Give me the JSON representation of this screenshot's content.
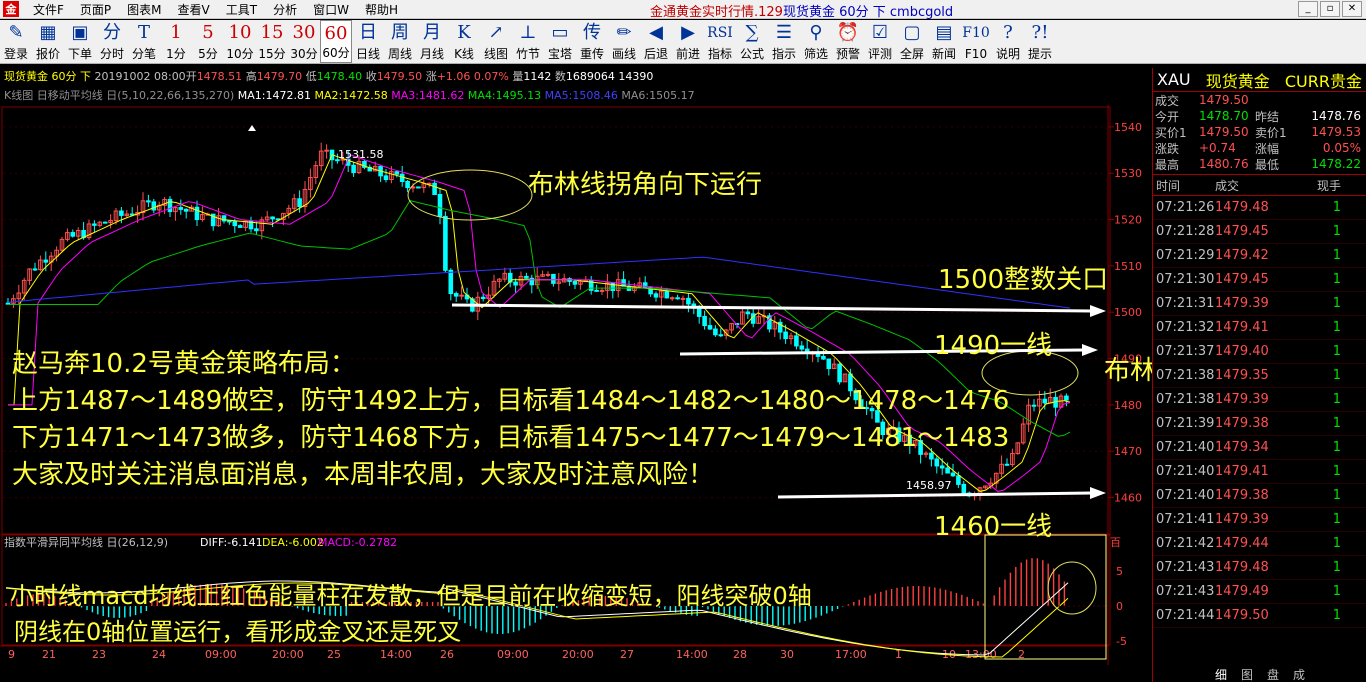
{
  "menubar": {
    "items": [
      "文件F",
      "页面P",
      "图表M",
      "查看V",
      "工具T",
      "分析",
      "窗口W",
      "帮助H"
    ],
    "title_prefix": "金通黄金实时行情.129",
    "title_main": "现货黄金 60分 下 cmbcgold"
  },
  "toolbar": [
    {
      "icon": "✎",
      "label": "登录"
    },
    {
      "icon": "▦",
      "label": "报价"
    },
    {
      "icon": "▣",
      "label": "下单"
    },
    {
      "icon": "分",
      "label": "分时"
    },
    {
      "icon": "T",
      "label": "分笔"
    },
    {
      "icon": "1",
      "label": "1分"
    },
    {
      "icon": "5",
      "label": "5分"
    },
    {
      "icon": "10",
      "label": "10分"
    },
    {
      "icon": "15",
      "label": "15分"
    },
    {
      "icon": "30",
      "label": "30分"
    },
    {
      "icon": "60",
      "label": "60分"
    },
    {
      "icon": "日",
      "label": "日线"
    },
    {
      "icon": "周",
      "label": "周线"
    },
    {
      "icon": "月",
      "label": "月线"
    },
    {
      "icon": "K",
      "label": "K线"
    },
    {
      "icon": "↗",
      "label": "线图"
    },
    {
      "icon": "⊥",
      "label": "竹节"
    },
    {
      "icon": "▭",
      "label": "宝塔"
    },
    {
      "icon": "传",
      "label": "重传"
    },
    {
      "icon": "✏",
      "label": "画线"
    },
    {
      "icon": "◀",
      "label": "后退"
    },
    {
      "icon": "▶",
      "label": "前进"
    },
    {
      "icon": "RSI",
      "label": "指标"
    },
    {
      "icon": "∑",
      "label": "公式"
    },
    {
      "icon": "☰",
      "label": "指示"
    },
    {
      "icon": "⚲",
      "label": "筛选"
    },
    {
      "icon": "⏰",
      "label": "预警"
    },
    {
      "icon": "☑",
      "label": "评测"
    },
    {
      "icon": "▢",
      "label": "全屏"
    },
    {
      "icon": "▤",
      "label": "新闻"
    },
    {
      "icon": "F10",
      "label": "F10"
    },
    {
      "icon": "?",
      "label": "说明"
    },
    {
      "icon": "?!",
      "label": "提示"
    }
  ],
  "infobar": {
    "symbol": "现货黄金 60分 下",
    "date": "20191002 08:00",
    "open_label": "开",
    "open": "1478.51",
    "high_label": "高",
    "high": "1479.70",
    "low_label": "低",
    "low": "1478.40",
    "close_label": "收",
    "close": "1479.50",
    "chg_label": "涨",
    "chg": "+1.06",
    "pct": "0.07%",
    "vol_label": "量",
    "vol": "1142",
    "oi_label": "数",
    "oi": "1689064",
    "extra": "14390"
  },
  "mabar": {
    "name": "K线图 日移动平均线 日(5,10,22,66,135,270)",
    "ma1": "MA1:1472.81",
    "ma2": "MA2:1472.58",
    "ma3": "MA3:1481.62",
    "ma4": "MA4:1495.13",
    "ma5": "MA5:1508.46",
    "ma6": "MA6:1505.17"
  },
  "colors": {
    "up": "#ff5050",
    "down": "#00ffff",
    "ma1": "#ffffff",
    "ma2": "#ffff00",
    "ma3": "#ff00ff",
    "ma4": "#00c000",
    "ma5": "#3030ff",
    "grid": "#800000",
    "annotation": "#ffff40"
  },
  "chart_data": {
    "type": "candlestick",
    "y_ticks": [
      1540,
      1530,
      1520,
      1510,
      1500,
      1490,
      1480,
      1470,
      1460
    ],
    "ylim": [
      1453,
      1543
    ],
    "x_ticks": [
      "9",
      "21",
      "23",
      "24",
      "09:00",
      "20:00",
      "25",
      "14:00",
      "26",
      "09:00",
      "20:00",
      "27",
      "14:00",
      "28",
      "30",
      "17:00",
      "1",
      "10",
      "13:00",
      "2"
    ],
    "marker_high": "1531.58",
    "marker_low": "1458.97",
    "macd": {
      "title": "指数平滑异同平均线 日(26,12,9)",
      "diff": "DIFF:-6.141",
      "dea": "DEA:-6.002",
      "macd": "MACD:-0.2782",
      "y_ticks": [
        "5",
        "0",
        "-5"
      ],
      "corner_label": "百"
    }
  },
  "annotations": {
    "boll_turn": "布林线拐角向下运行",
    "level_1500": "1500整数关口",
    "level_1490": "1490一线",
    "boll_down": "布林线向下运行",
    "level_1460": "1460一线",
    "strategy_title": "赵马奔10.2号黄金策略布局：",
    "strategy_up": "上方1487～1489做空，防守1492上方，目标看1484～1482～1480～1478～1476",
    "strategy_down": "下方1471～1473做多，防守1468下方，目标看1475～1477～1479～1481～1483",
    "strategy_note": "大家及时关注消息面消息，本周非农周，大家及时注意风险！",
    "macd_note1": "小时线macd均线上红色能量柱在发散，但是目前在收缩变短，阳线突破0轴",
    "macd_note2": "阴线在0轴位置运行，看形成金叉还是死叉"
  },
  "quote": {
    "code": "XAU",
    "name": "现货黄金",
    "currency": "CURR贵金",
    "rows": [
      {
        "l1": "成交",
        "v1": "1479.50",
        "l2": "",
        "v2": ""
      },
      {
        "l1": "今开",
        "v1": "1478.70",
        "l2": "昨结",
        "v2": "1478.76"
      },
      {
        "l1": "买价1",
        "v1": "1479.50",
        "l2": "卖价1",
        "v2": "1479.53"
      },
      {
        "l1": "涨跌",
        "v1": "+0.74",
        "l2": "涨幅",
        "v2": "0.05%"
      },
      {
        "l1": "最高",
        "v1": "1480.76",
        "l2": "最低",
        "v2": "1478.22"
      }
    ],
    "tick_headers": [
      "时间",
      "成交",
      "现手"
    ],
    "ticks": [
      {
        "t": "07:21:26",
        "p": "1479.48",
        "v": "1"
      },
      {
        "t": "07:21:28",
        "p": "1479.45",
        "v": "1"
      },
      {
        "t": "07:21:29",
        "p": "1479.42",
        "v": "1"
      },
      {
        "t": "07:21:30",
        "p": "1479.45",
        "v": "1"
      },
      {
        "t": "07:21:31",
        "p": "1479.39",
        "v": "1"
      },
      {
        "t": "07:21:32",
        "p": "1479.41",
        "v": "1"
      },
      {
        "t": "07:21:37",
        "p": "1479.40",
        "v": "1"
      },
      {
        "t": "07:21:38",
        "p": "1479.35",
        "v": "1"
      },
      {
        "t": "07:21:38",
        "p": "1479.39",
        "v": "1"
      },
      {
        "t": "07:21:39",
        "p": "1479.38",
        "v": "1"
      },
      {
        "t": "07:21:40",
        "p": "1479.34",
        "v": "1"
      },
      {
        "t": "07:21:40",
        "p": "1479.41",
        "v": "1"
      },
      {
        "t": "07:21:40",
        "p": "1479.38",
        "v": "1"
      },
      {
        "t": "07:21:41",
        "p": "1479.39",
        "v": "1"
      },
      {
        "t": "07:21:42",
        "p": "1479.44",
        "v": "1"
      },
      {
        "t": "07:21:43",
        "p": "1479.48",
        "v": "1"
      },
      {
        "t": "07:21:43",
        "p": "1479.49",
        "v": "1"
      },
      {
        "t": "07:21:44",
        "p": "1479.50",
        "v": "1"
      }
    ],
    "tabs": [
      "细",
      "图",
      "盘",
      "成"
    ]
  }
}
